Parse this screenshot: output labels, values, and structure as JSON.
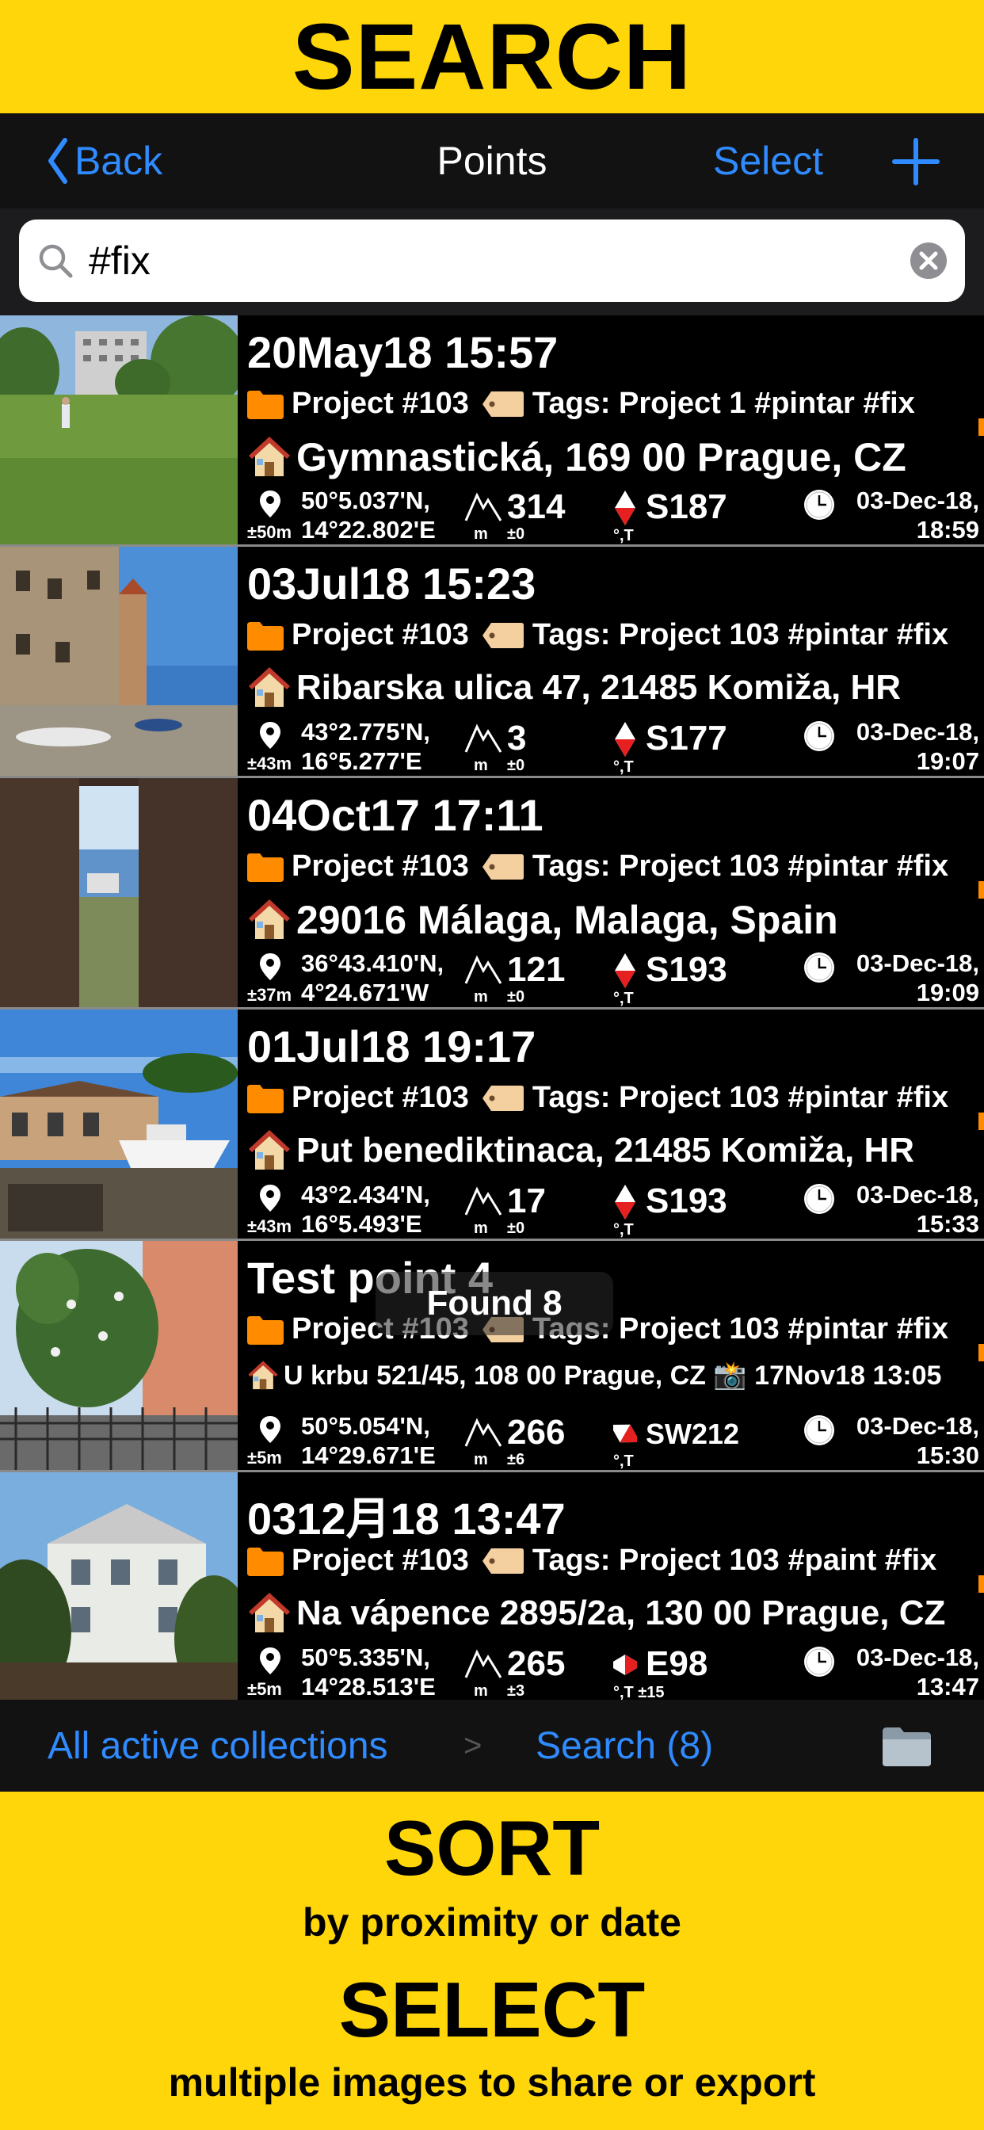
{
  "promo": {
    "top_heading": "SEARCH",
    "sort_heading": "SORT",
    "sort_sub": "by proximity or date",
    "select_heading": "SELECT",
    "select_sub": "multiple images to share or export"
  },
  "nav": {
    "back_label": "Back",
    "title": "Points",
    "select_label": "Select"
  },
  "search": {
    "query": "#fix"
  },
  "colors": {
    "banner": "#FFD60A",
    "accent": "#2F8BFF",
    "folder": "#FF8C00"
  },
  "rows": [
    {
      "title": "20May18 15:57",
      "project": "Project #103",
      "tags": "Tags: Project 1 #pintar #fix",
      "address": "Gymnastická, 169 00 Prague, CZ",
      "acc": "±50m",
      "lat": "50°5.037'N,",
      "lon": "14°22.802'E",
      "alt": "314",
      "alt_unit": "m",
      "alt_pm": "±0",
      "bearing": "S187",
      "bearing_unit": "°,T",
      "date1": "03-Dec-18,",
      "date2": "18:59"
    },
    {
      "title": "03Jul18 15:23",
      "project": "Project #103",
      "tags": "Tags: Project 103 #pintar #fix",
      "address": "Ribarska ulica 47, 21485 Komiža, HR",
      "acc": "±43m",
      "lat": "43°2.775'N,",
      "lon": "16°5.277'E",
      "alt": "3",
      "alt_unit": "m",
      "alt_pm": "±0",
      "bearing": "S177",
      "bearing_unit": "°,T",
      "date1": "03-Dec-18,",
      "date2": "19:07"
    },
    {
      "title": "04Oct17 17:11",
      "project": "Project #103",
      "tags": "Tags: Project 103 #pintar #fix",
      "address": "29016 Málaga, Malaga, Spain",
      "acc": "±37m",
      "lat": "36°43.410'N,",
      "lon": "4°24.671'W",
      "alt": "121",
      "alt_unit": "m",
      "alt_pm": "±0",
      "bearing": "S193",
      "bearing_unit": "°,T",
      "date1": "03-Dec-18,",
      "date2": "19:09"
    },
    {
      "title": "01Jul18 19:17",
      "project": "Project #103",
      "tags": "Tags: Project 103 #pintar #fix",
      "address": "Put benediktinaca, 21485 Komiža, HR",
      "acc": "±43m",
      "lat": "43°2.434'N,",
      "lon": "16°5.493'E",
      "alt": "17",
      "alt_unit": "m",
      "alt_pm": "±0",
      "bearing": "S193",
      "bearing_unit": "°,T",
      "date1": "03-Dec-18,",
      "date2": "15:33"
    },
    {
      "title": "Test point 4",
      "project": "Project #103",
      "tags": "Tags: Project 103 #pintar #fix",
      "address": "U krbu 521/45, 108 00 Prague, CZ 📸 17Nov18 13:05",
      "acc": "±5m",
      "lat": "50°5.054'N,",
      "lon": "14°29.671'E",
      "alt": "266",
      "alt_unit": "m",
      "alt_pm": "±6",
      "bearing": "SW212",
      "bearing_unit": "°,T",
      "date1": "03-Dec-18,",
      "date2": "15:30"
    },
    {
      "title": "0312月18 13:47",
      "project": "Project #103",
      "tags": "Tags: Project 103 #paint #fix",
      "address": "Na vápence 2895/2a, 130 00 Prague, CZ",
      "acc": "±5m",
      "lat": "50°5.335'N,",
      "lon": "14°28.513'E",
      "alt": "265",
      "alt_unit": "m",
      "alt_pm": "±3",
      "bearing": "E98",
      "bearing_unit": "°,T ±15",
      "date1": "03-Dec-18,",
      "date2": "13:47"
    }
  ],
  "overlay": {
    "found": "Found 8"
  },
  "bottom_bar": {
    "collections": "All active collections",
    "separator": ">",
    "search": "Search (8)"
  }
}
